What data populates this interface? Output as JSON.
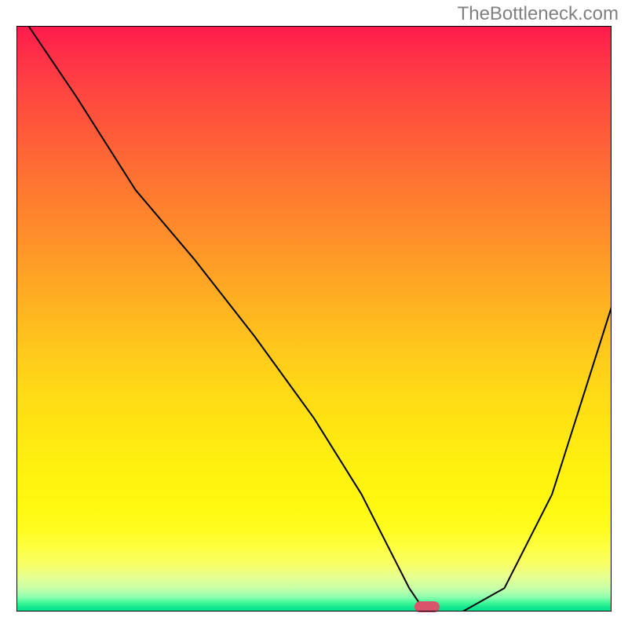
{
  "watermark": "TheBottleneck.com",
  "chart_data": {
    "type": "line",
    "title": "",
    "xlabel": "",
    "ylabel": "",
    "xlim": [
      0,
      100
    ],
    "ylim": [
      0,
      100
    ],
    "series": [
      {
        "name": "curve",
        "x": [
          2,
          10,
          20,
          30,
          40,
          50,
          58,
          63,
          66,
          68,
          70,
          75,
          82,
          90,
          100
        ],
        "y": [
          100,
          88,
          72,
          60,
          47,
          33,
          20,
          10,
          4,
          1,
          0,
          0,
          4,
          20,
          52
        ]
      }
    ],
    "marker": {
      "x": 69,
      "y": 0
    },
    "background_gradient": {
      "top": "#ff1a4d",
      "mid1": "#ff8f2a",
      "mid2": "#ffe412",
      "bottom": "#00e090"
    }
  }
}
